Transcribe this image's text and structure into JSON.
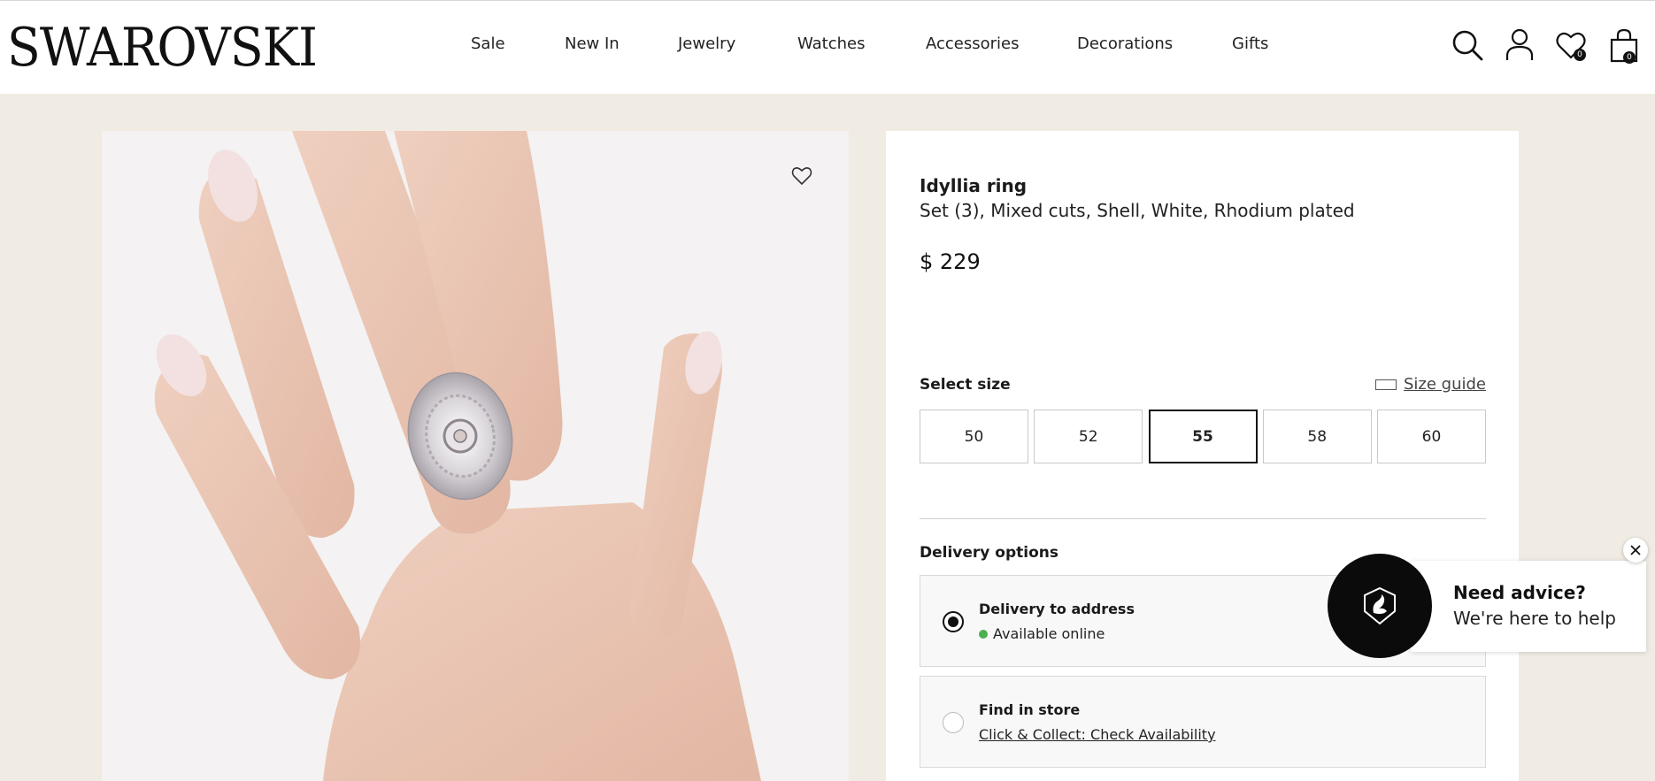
{
  "header": {
    "logo": "SWAROVSKI",
    "nav": [
      "Sale",
      "New In",
      "Jewelry",
      "Watches",
      "Accessories",
      "Decorations",
      "Gifts"
    ],
    "icons": {
      "search": "search-icon",
      "account": "user-icon",
      "wishlist": "heart-icon",
      "bag": "shopping-bag-icon"
    },
    "wishlist_count": "0",
    "bag_count": "0"
  },
  "product": {
    "image_alt": "Hand wearing Idyllia ring",
    "name": "Idyllia ring",
    "subtitle": "Set (3), Mixed cuts, Shell, White, Rhodium plated",
    "price": "$ 229"
  },
  "size": {
    "title": "Select size",
    "guide_label": "Size guide",
    "options": [
      "50",
      "52",
      "55",
      "58",
      "60"
    ],
    "selected": "55"
  },
  "delivery": {
    "title": "Delivery options",
    "options": [
      {
        "title": "Delivery to address",
        "status": "Available online",
        "selected": true
      },
      {
        "title": "Find in store",
        "link": "Click & Collect: Check Availability",
        "selected": false
      }
    ]
  },
  "chat": {
    "title": "Need advice?",
    "subtitle": "We're here to help"
  },
  "colors": {
    "page_bg": "#f0ece4",
    "available_green": "#4caf50",
    "dark": "#111111"
  }
}
